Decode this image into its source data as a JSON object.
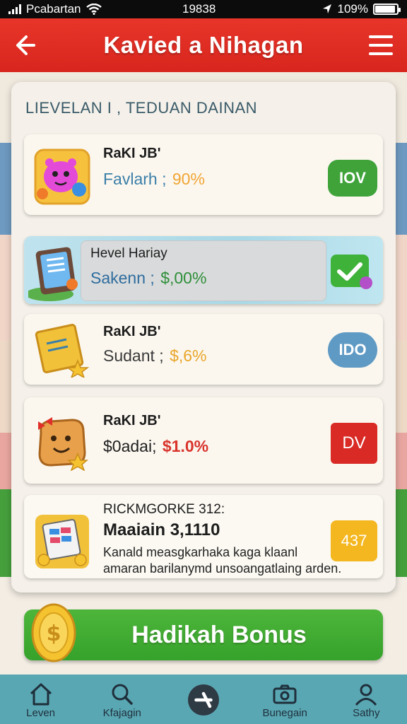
{
  "status_bar": {
    "carrier": "Pcabartan",
    "time": "19838",
    "battery": "109%"
  },
  "header": {
    "title": "Kavied a Nihagan",
    "back_icon": "arrow-left-icon",
    "menu_icon": "hamburger-menu-icon"
  },
  "section": {
    "title": "LIEVELAN I , TEDUAN DAINAN"
  },
  "offers": [
    {
      "title": "RaKI JB'",
      "reward_label": "Favlarh ;",
      "reward_value": "90%",
      "button": "IOV",
      "button_color": "#3fa33a",
      "value_color": "#f1a534",
      "label_color": "#3b7fa8",
      "icon": "pink-monster-icon"
    },
    {
      "title": "Hevel Hariay",
      "reward_label": "Sakenn ;",
      "reward_value": "$,00%",
      "button_icon": "checkmark-icon",
      "button_color": "#3fb23a",
      "value_color": "#2e8f3a",
      "label_color": "#2f6d9e",
      "icon": "tablet-icon"
    },
    {
      "title": "RaKI JB'",
      "reward_label": "Sudant ;",
      "reward_value": "$,6%",
      "button": "IDO",
      "button_color": "#5f9ac4",
      "value_color": "#e9a62a",
      "label_color": "#3a3a3a",
      "icon": "treasure-map-icon"
    },
    {
      "title": "RaKI JB'",
      "reward_label": "$0adai;",
      "reward_value": "$1.0%",
      "button": "DV",
      "button_color": "#d92a25",
      "value_color": "#d8342c",
      "label_color": "#1f1f1f",
      "icon": "cookie-face-icon"
    },
    {
      "title": "RICKMGORKE 312:",
      "subtitle": "Maaiain 3,1110",
      "description": "Kanald measgkarhaka kaga klaanl amaran barilanymd unsoangatlaing arden.",
      "button": "437",
      "button_color": "#f5b71f",
      "icon": "chart-scroll-icon"
    }
  ],
  "bonus": {
    "label": "Hadikah Bonus",
    "icon": "gold-coin-icon"
  },
  "nav": {
    "items": [
      {
        "label": "Leven",
        "icon": "home-icon"
      },
      {
        "label": "Kfajagin",
        "icon": "search-icon"
      },
      {
        "label": "",
        "icon": "close-icon"
      },
      {
        "label": "Bunegain",
        "icon": "camera-icon"
      },
      {
        "label": "Sathy",
        "icon": "profile-icon"
      }
    ]
  }
}
